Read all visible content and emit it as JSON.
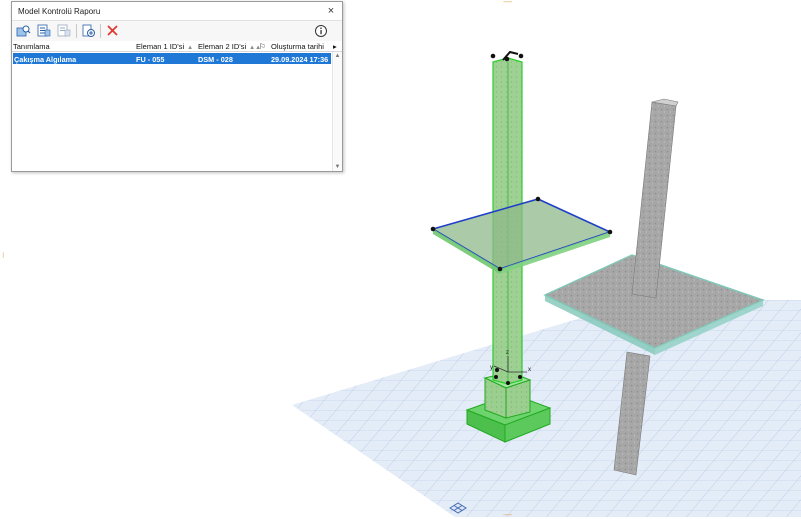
{
  "palette": {
    "title": "Model Kontrolü Raporu",
    "close_glyph": "×",
    "toolbar": {
      "icons": [
        "find-elements-icon",
        "report-details-icon",
        "report-summary-icon",
        "export-report-icon",
        "delete-icon",
        "info-icon"
      ]
    },
    "columns": {
      "description": "Tanımlama",
      "element1": "Eleman 1 ID'si",
      "element2": "Eleman 2 ID'si",
      "created": "Oluşturma tarihi"
    },
    "rows": [
      {
        "description": "Çakışma Algılama",
        "element1": "FU - 055",
        "element2": "DSM - 028",
        "created": "29.09.2024 17:36"
      }
    ]
  },
  "colors": {
    "selection": "#1f78d6",
    "selected_element": "#3fd23f",
    "slab_outline": "#1f3fc8",
    "grid": "#9ab6dc",
    "concrete": "#a8a8a8",
    "slab_edge": "#7fc7b7"
  }
}
